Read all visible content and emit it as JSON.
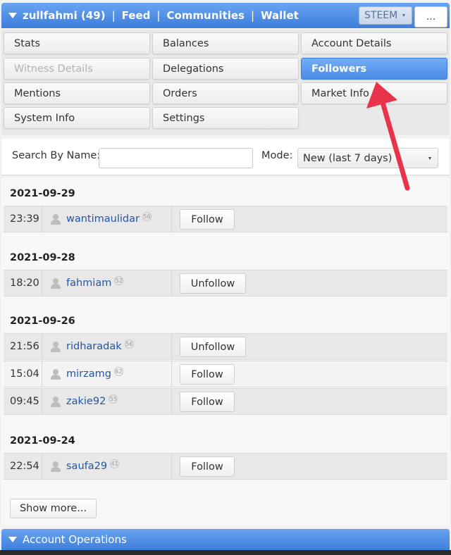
{
  "header": {
    "account": "zullfahmi (49)",
    "nav": [
      "Feed",
      "Communities",
      "Wallet"
    ],
    "sep": "|",
    "coin": "STEEM",
    "more": "..."
  },
  "menu": {
    "items": [
      {
        "label": "Stats"
      },
      {
        "label": "Balances"
      },
      {
        "label": "Account Details"
      },
      {
        "label": "Witness Details",
        "state": "disabled"
      },
      {
        "label": "Delegations"
      },
      {
        "label": "Followers",
        "state": "active"
      },
      {
        "label": "Mentions"
      },
      {
        "label": "Orders"
      },
      {
        "label": "Market Info"
      },
      {
        "label": "System Info"
      },
      {
        "label": "Settings"
      }
    ]
  },
  "search": {
    "label": "Search By Name:",
    "value": "",
    "mode_label": "Mode:",
    "mode_value": "New (last 7 days)"
  },
  "groups": [
    {
      "date": "2021-09-29",
      "rows": [
        {
          "time": "23:39",
          "user": "wantimaulidar",
          "rep": "56",
          "action": "Follow"
        }
      ]
    },
    {
      "date": "2021-09-28",
      "rows": [
        {
          "time": "18:20",
          "user": "fahmiam",
          "rep": "52",
          "action": "Unfollow"
        }
      ]
    },
    {
      "date": "2021-09-26",
      "rows": [
        {
          "time": "21:56",
          "user": "ridharadak",
          "rep": "56",
          "action": "Unfollow"
        },
        {
          "time": "15:04",
          "user": "mirzamg",
          "rep": "62",
          "action": "Follow"
        },
        {
          "time": "09:45",
          "user": "zakie92",
          "rep": "55",
          "action": "Follow"
        }
      ]
    },
    {
      "date": "2021-09-24",
      "rows": [
        {
          "time": "22:54",
          "user": "saufa29",
          "rep": "41",
          "action": "Follow"
        }
      ]
    }
  ],
  "show_more": "Show more...",
  "account_operations": "Account Operations",
  "colors": {
    "accent": "#3d7fdc",
    "annotation_arrow": "#e8334a",
    "link": "#2456a4"
  }
}
